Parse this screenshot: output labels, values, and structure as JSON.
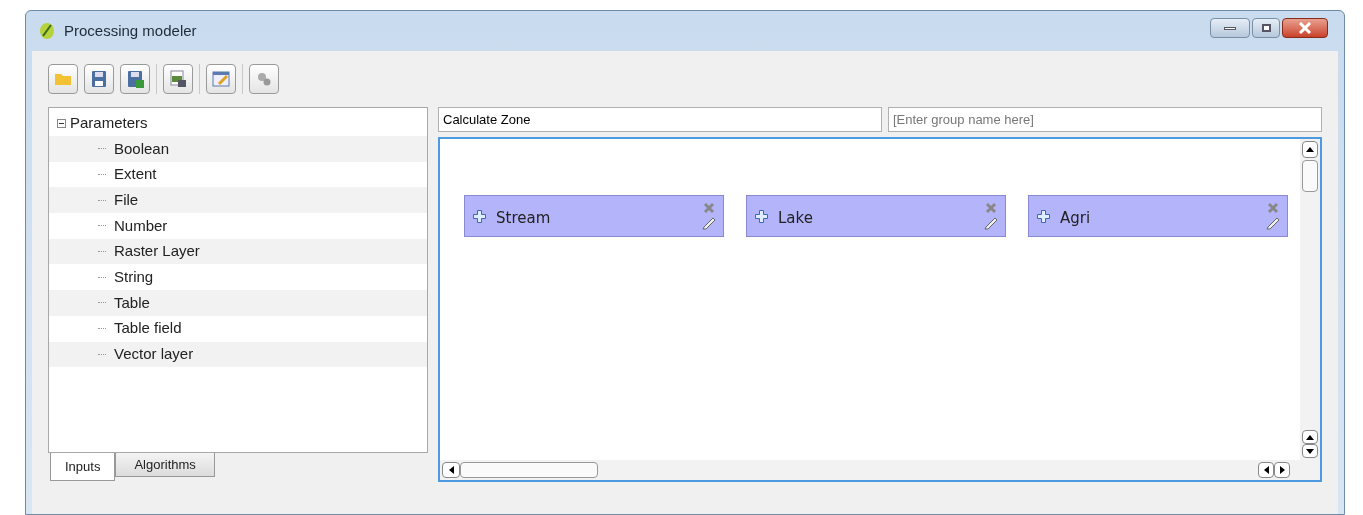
{
  "window": {
    "title": "Processing modeler"
  },
  "toolbar": [
    {
      "kind": "open"
    },
    {
      "kind": "save"
    },
    {
      "kind": "saveas"
    },
    {
      "kind": "export"
    },
    {
      "kind": "edit"
    },
    {
      "kind": "run"
    }
  ],
  "tree": {
    "label": "Parameters",
    "expanded": true,
    "children": [
      {
        "label": "Boolean"
      },
      {
        "label": "Extent"
      },
      {
        "label": "File"
      },
      {
        "label": "Number"
      },
      {
        "label": "Raster Layer"
      },
      {
        "label": "String"
      },
      {
        "label": "Table"
      },
      {
        "label": "Table field"
      },
      {
        "label": "Vector layer"
      }
    ]
  },
  "tabs": [
    {
      "label": "Inputs",
      "selected": true
    },
    {
      "label": "Algorithms",
      "selected": false
    }
  ],
  "model_name": {
    "value": "Calculate Zone"
  },
  "group_name": {
    "placeholder": "[Enter group name here]"
  },
  "nodes": [
    {
      "label": "Stream"
    },
    {
      "label": "Lake"
    },
    {
      "label": "Agri"
    }
  ]
}
